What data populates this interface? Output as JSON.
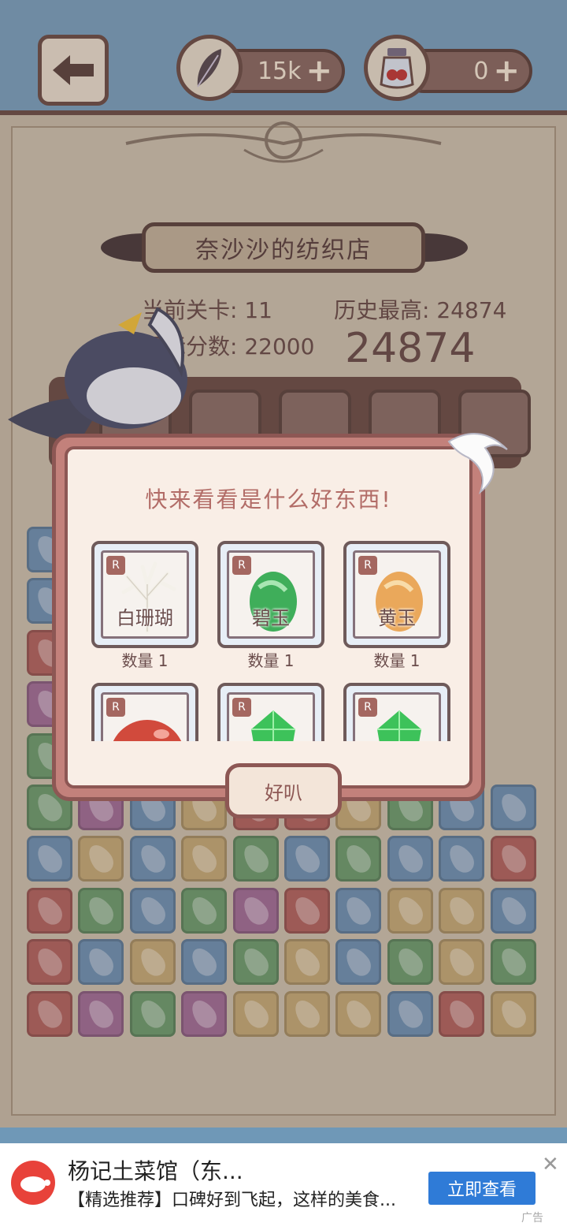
{
  "header": {
    "feather_count": "15k",
    "potion_count": "0",
    "plus_symbol": "+"
  },
  "shop": {
    "title": "奈沙沙的纺织店"
  },
  "stats": {
    "current_level_label": "当前关卡:",
    "current_level_value": "11",
    "history_best_label": "历史最高:",
    "history_best_value": "24874",
    "target_score_label": "目标分数:",
    "target_score_value": "22000",
    "current_score": "24874"
  },
  "dialog": {
    "title": "快来看看是什么好东西!",
    "ok_label": "好叭",
    "rarity_badge": "R",
    "items": [
      {
        "name": "白珊瑚",
        "qty_label": "数量 1"
      },
      {
        "name": "碧玉",
        "qty_label": "数量 1"
      },
      {
        "name": "黄玉",
        "qty_label": "数量 1"
      },
      {
        "name": "",
        "qty_label": ""
      },
      {
        "name": "",
        "qty_label": ""
      },
      {
        "name": "",
        "qty_label": ""
      }
    ]
  },
  "tile_colors": {
    "blue": "#6f93b4",
    "green": "#6e9e6f",
    "red": "#b26661",
    "purple": "#a27098",
    "yellow": "#c5ab78"
  },
  "ad": {
    "title": "杨记土菜馆（东...",
    "desc": "【精选推荐】口碑好到飞起，这样的美食...",
    "button": "立即查看",
    "close": "✕",
    "tag": "广告"
  }
}
